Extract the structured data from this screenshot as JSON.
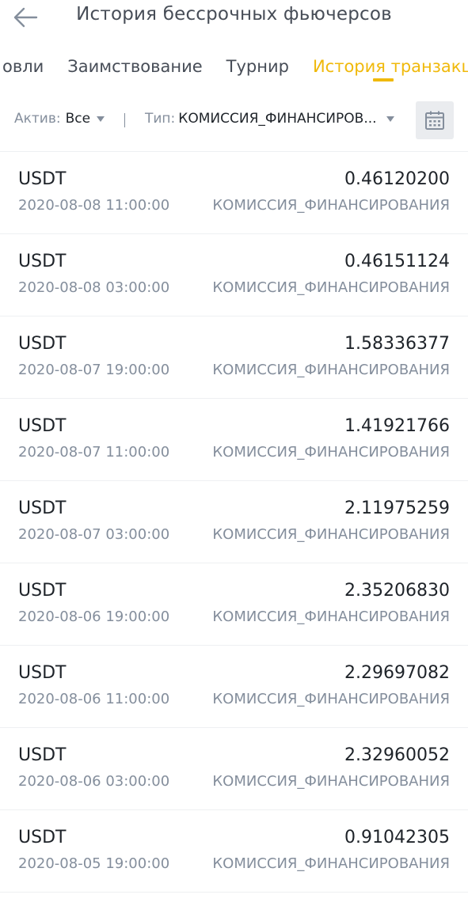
{
  "header": {
    "title": "История бессрочных фьючерсов",
    "back_icon": "arrow-left-icon"
  },
  "tabs": [
    {
      "label": "овли",
      "active": false
    },
    {
      "label": "Заимствование",
      "active": false
    },
    {
      "label": "Турнир",
      "active": false
    },
    {
      "label": "История транзакций",
      "active": true
    }
  ],
  "filters": {
    "asset": {
      "label": "Актив:",
      "value": "Все"
    },
    "type": {
      "label": "Тип:",
      "value": "КОМИССИЯ_ФИНАНСИРОВ..."
    },
    "calendar_icon": "calendar-icon"
  },
  "transactions": [
    {
      "asset": "USDT",
      "amount": "0.46120200",
      "time": "2020-08-08 11:00:00",
      "type": "КОМИССИЯ_ФИНАНСИРОВАНИЯ"
    },
    {
      "asset": "USDT",
      "amount": "0.46151124",
      "time": "2020-08-08 03:00:00",
      "type": "КОМИССИЯ_ФИНАНСИРОВАНИЯ"
    },
    {
      "asset": "USDT",
      "amount": "1.58336377",
      "time": "2020-08-07 19:00:00",
      "type": "КОМИССИЯ_ФИНАНСИРОВАНИЯ"
    },
    {
      "asset": "USDT",
      "amount": "1.41921766",
      "time": "2020-08-07 11:00:00",
      "type": "КОМИССИЯ_ФИНАНСИРОВАНИЯ"
    },
    {
      "asset": "USDT",
      "amount": "2.11975259",
      "time": "2020-08-07 03:00:00",
      "type": "КОМИССИЯ_ФИНАНСИРОВАНИЯ"
    },
    {
      "asset": "USDT",
      "amount": "2.35206830",
      "time": "2020-08-06 19:00:00",
      "type": "КОМИССИЯ_ФИНАНСИРОВАНИЯ"
    },
    {
      "asset": "USDT",
      "amount": "2.29697082",
      "time": "2020-08-06 11:00:00",
      "type": "КОМИССИЯ_ФИНАНСИРОВАНИЯ"
    },
    {
      "asset": "USDT",
      "amount": "2.32960052",
      "time": "2020-08-06 03:00:00",
      "type": "КОМИССИЯ_ФИНАНСИРОВАНИЯ"
    },
    {
      "asset": "USDT",
      "amount": "0.91042305",
      "time": "2020-08-05 19:00:00",
      "type": "КОМИССИЯ_ФИНАНСИРОВАНИЯ"
    }
  ],
  "colors": {
    "accent": "#f0b90b",
    "text_primary": "#1e2329",
    "text_secondary": "#848e9c",
    "divider": "#eef0f2"
  }
}
